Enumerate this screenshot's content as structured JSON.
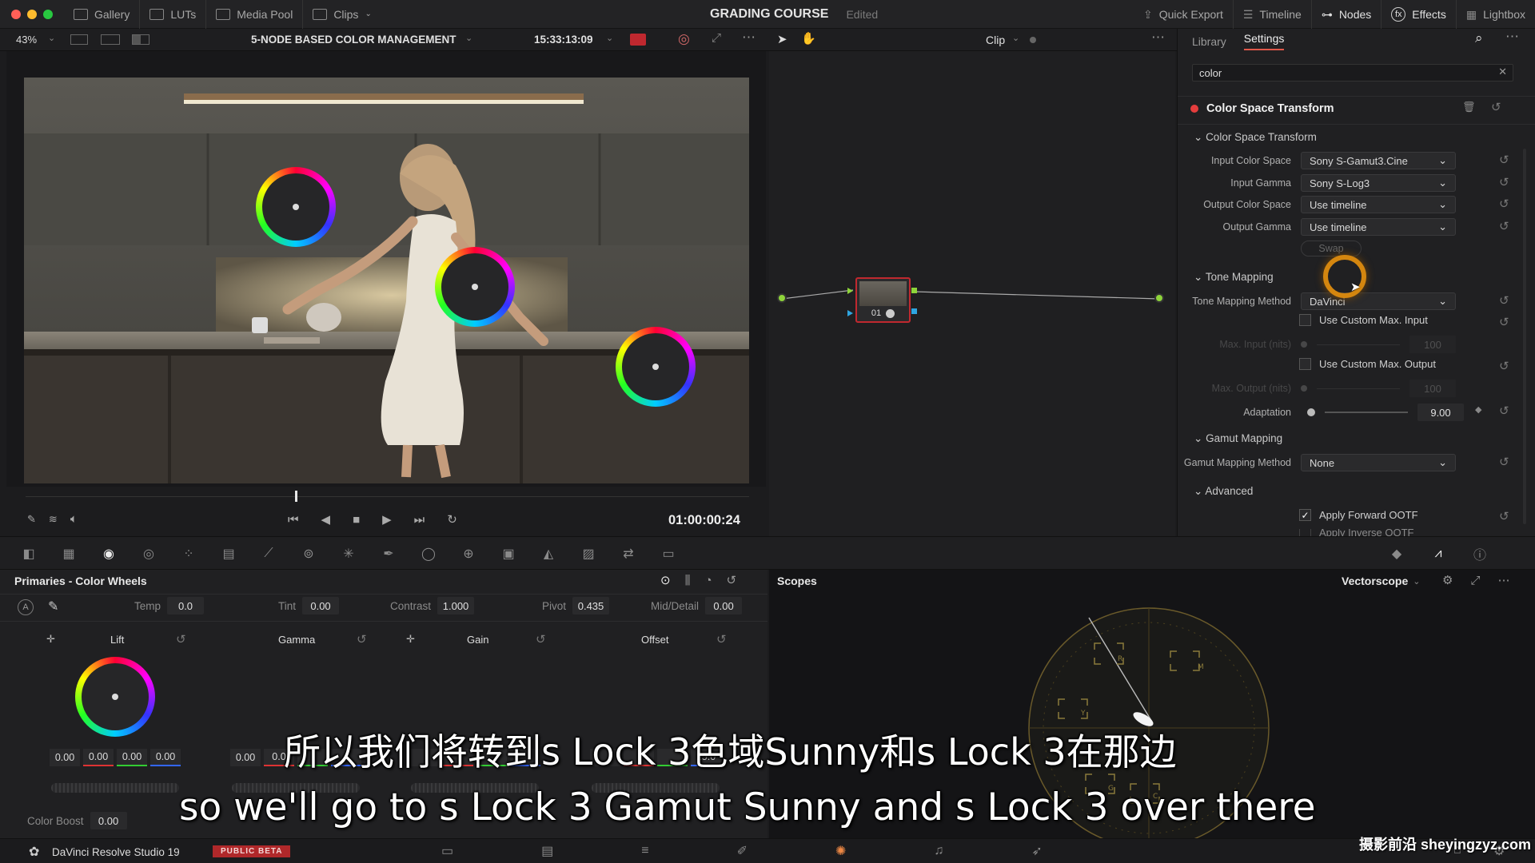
{
  "window": {
    "title": "GRADING COURSE",
    "status": "Edited"
  },
  "topnav": {
    "left": [
      "Gallery",
      "LUTs",
      "Media Pool",
      "Clips"
    ],
    "right": [
      "Quick Export",
      "Timeline",
      "Nodes",
      "Effects",
      "Lightbox"
    ]
  },
  "viewer": {
    "zoom": "43%",
    "clip_name": "5-NODE BASED COLOR MANAGEMENT",
    "source_timecode": "15:33:13:09",
    "timecode": "01:00:00:24"
  },
  "nodes": {
    "mode": "Clip",
    "node_label": "01"
  },
  "right_panel": {
    "tabs": [
      "Library",
      "Settings"
    ],
    "active_tab": "Settings",
    "search_value": "color",
    "effect_title": "Color Space Transform",
    "csts": {
      "section": "Color Space Transform",
      "input_color_space_label": "Input Color Space",
      "input_color_space": "Sony S-Gamut3.Cine",
      "input_gamma_label": "Input Gamma",
      "input_gamma": "Sony S-Log3",
      "output_color_space_label": "Output Color Space",
      "output_color_space": "Use timeline",
      "output_gamma_label": "Output Gamma",
      "output_gamma": "Use timeline",
      "swap": "Swap"
    },
    "tone": {
      "section": "Tone Mapping",
      "method_label": "Tone Mapping Method",
      "method": "DaVinci",
      "custom_input": "Use Custom Max. Input",
      "max_input_label": "Max. Input (nits)",
      "max_input": "100",
      "custom_output": "Use Custom Max. Output",
      "max_output_label": "Max. Output (nits)",
      "max_output": "100",
      "adaptation_label": "Adaptation",
      "adaptation": "9.00"
    },
    "gamut": {
      "section": "Gamut Mapping",
      "method_label": "Gamut Mapping Method",
      "method": "None"
    },
    "advanced": {
      "section": "Advanced",
      "forward_ootf": "Apply Forward OOTF",
      "inverse_ootf": "Apply Inverse OOTF"
    }
  },
  "primaries": {
    "title": "Primaries - Color Wheels",
    "temp_label": "Temp",
    "temp": "0.0",
    "tint_label": "Tint",
    "tint": "0.00",
    "contrast_label": "Contrast",
    "contrast": "1.000",
    "pivot_label": "Pivot",
    "pivot": "0.435",
    "middetail_label": "Mid/Detail",
    "middetail": "0.00",
    "wheels": [
      {
        "name": "Lift",
        "values": [
          "0.00",
          "0.00",
          "0.00",
          "0.00"
        ]
      },
      {
        "name": "Gamma",
        "values": [
          "0.00",
          "0.0",
          "",
          ""
        ]
      },
      {
        "name": "Gain",
        "values": [
          "",
          "",
          "",
          ""
        ]
      },
      {
        "name": "Offset",
        "values": [
          "",
          "",
          "",
          "25.0"
        ]
      }
    ],
    "color_boost_label": "Color Boost",
    "color_boost": "0.00"
  },
  "scopes": {
    "title": "Scopes",
    "type": "Vectorscope"
  },
  "statusbar": {
    "app": "DaVinci Resolve Studio 19",
    "badge": "PUBLIC BETA",
    "badge_color": "#b0282a"
  },
  "subtitles": {
    "chinese": "所以我们将转到s Lock 3色域Sunny和s Lock 3在那边",
    "english": "so we'll go to s Lock 3 Gamut Sunny and s Lock 3 over there"
  },
  "watermark": "摄影前沿 sheyingzyz.com",
  "colors": {
    "accent": "#e0584a",
    "orange_ring": "#d4860f",
    "node_red": "#c0282f"
  }
}
